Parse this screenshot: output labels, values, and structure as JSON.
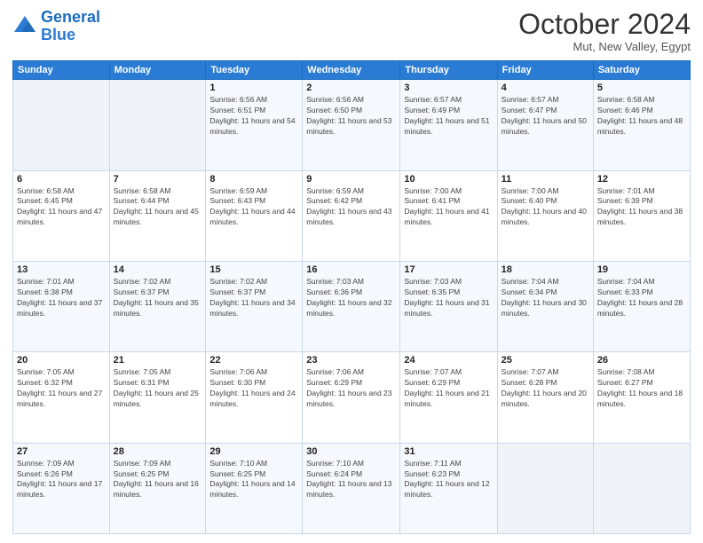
{
  "header": {
    "logo_line1": "General",
    "logo_line2": "Blue",
    "title": "October 2024",
    "subtitle": "Mut, New Valley, Egypt"
  },
  "columns": [
    "Sunday",
    "Monday",
    "Tuesday",
    "Wednesday",
    "Thursday",
    "Friday",
    "Saturday"
  ],
  "weeks": [
    [
      {
        "day": "",
        "sunrise": "",
        "sunset": "",
        "daylight": ""
      },
      {
        "day": "",
        "sunrise": "",
        "sunset": "",
        "daylight": ""
      },
      {
        "day": "1",
        "sunrise": "Sunrise: 6:56 AM",
        "sunset": "Sunset: 6:51 PM",
        "daylight": "Daylight: 11 hours and 54 minutes."
      },
      {
        "day": "2",
        "sunrise": "Sunrise: 6:56 AM",
        "sunset": "Sunset: 6:50 PM",
        "daylight": "Daylight: 11 hours and 53 minutes."
      },
      {
        "day": "3",
        "sunrise": "Sunrise: 6:57 AM",
        "sunset": "Sunset: 6:49 PM",
        "daylight": "Daylight: 11 hours and 51 minutes."
      },
      {
        "day": "4",
        "sunrise": "Sunrise: 6:57 AM",
        "sunset": "Sunset: 6:47 PM",
        "daylight": "Daylight: 11 hours and 50 minutes."
      },
      {
        "day": "5",
        "sunrise": "Sunrise: 6:58 AM",
        "sunset": "Sunset: 6:46 PM",
        "daylight": "Daylight: 11 hours and 48 minutes."
      }
    ],
    [
      {
        "day": "6",
        "sunrise": "Sunrise: 6:58 AM",
        "sunset": "Sunset: 6:45 PM",
        "daylight": "Daylight: 11 hours and 47 minutes."
      },
      {
        "day": "7",
        "sunrise": "Sunrise: 6:58 AM",
        "sunset": "Sunset: 6:44 PM",
        "daylight": "Daylight: 11 hours and 45 minutes."
      },
      {
        "day": "8",
        "sunrise": "Sunrise: 6:59 AM",
        "sunset": "Sunset: 6:43 PM",
        "daylight": "Daylight: 11 hours and 44 minutes."
      },
      {
        "day": "9",
        "sunrise": "Sunrise: 6:59 AM",
        "sunset": "Sunset: 6:42 PM",
        "daylight": "Daylight: 11 hours and 43 minutes."
      },
      {
        "day": "10",
        "sunrise": "Sunrise: 7:00 AM",
        "sunset": "Sunset: 6:41 PM",
        "daylight": "Daylight: 11 hours and 41 minutes."
      },
      {
        "day": "11",
        "sunrise": "Sunrise: 7:00 AM",
        "sunset": "Sunset: 6:40 PM",
        "daylight": "Daylight: 11 hours and 40 minutes."
      },
      {
        "day": "12",
        "sunrise": "Sunrise: 7:01 AM",
        "sunset": "Sunset: 6:39 PM",
        "daylight": "Daylight: 11 hours and 38 minutes."
      }
    ],
    [
      {
        "day": "13",
        "sunrise": "Sunrise: 7:01 AM",
        "sunset": "Sunset: 6:38 PM",
        "daylight": "Daylight: 11 hours and 37 minutes."
      },
      {
        "day": "14",
        "sunrise": "Sunrise: 7:02 AM",
        "sunset": "Sunset: 6:37 PM",
        "daylight": "Daylight: 11 hours and 35 minutes."
      },
      {
        "day": "15",
        "sunrise": "Sunrise: 7:02 AM",
        "sunset": "Sunset: 6:37 PM",
        "daylight": "Daylight: 11 hours and 34 minutes."
      },
      {
        "day": "16",
        "sunrise": "Sunrise: 7:03 AM",
        "sunset": "Sunset: 6:36 PM",
        "daylight": "Daylight: 11 hours and 32 minutes."
      },
      {
        "day": "17",
        "sunrise": "Sunrise: 7:03 AM",
        "sunset": "Sunset: 6:35 PM",
        "daylight": "Daylight: 11 hours and 31 minutes."
      },
      {
        "day": "18",
        "sunrise": "Sunrise: 7:04 AM",
        "sunset": "Sunset: 6:34 PM",
        "daylight": "Daylight: 11 hours and 30 minutes."
      },
      {
        "day": "19",
        "sunrise": "Sunrise: 7:04 AM",
        "sunset": "Sunset: 6:33 PM",
        "daylight": "Daylight: 11 hours and 28 minutes."
      }
    ],
    [
      {
        "day": "20",
        "sunrise": "Sunrise: 7:05 AM",
        "sunset": "Sunset: 6:32 PM",
        "daylight": "Daylight: 11 hours and 27 minutes."
      },
      {
        "day": "21",
        "sunrise": "Sunrise: 7:05 AM",
        "sunset": "Sunset: 6:31 PM",
        "daylight": "Daylight: 11 hours and 25 minutes."
      },
      {
        "day": "22",
        "sunrise": "Sunrise: 7:06 AM",
        "sunset": "Sunset: 6:30 PM",
        "daylight": "Daylight: 11 hours and 24 minutes."
      },
      {
        "day": "23",
        "sunrise": "Sunrise: 7:06 AM",
        "sunset": "Sunset: 6:29 PM",
        "daylight": "Daylight: 11 hours and 23 minutes."
      },
      {
        "day": "24",
        "sunrise": "Sunrise: 7:07 AM",
        "sunset": "Sunset: 6:29 PM",
        "daylight": "Daylight: 11 hours and 21 minutes."
      },
      {
        "day": "25",
        "sunrise": "Sunrise: 7:07 AM",
        "sunset": "Sunset: 6:28 PM",
        "daylight": "Daylight: 11 hours and 20 minutes."
      },
      {
        "day": "26",
        "sunrise": "Sunrise: 7:08 AM",
        "sunset": "Sunset: 6:27 PM",
        "daylight": "Daylight: 11 hours and 18 minutes."
      }
    ],
    [
      {
        "day": "27",
        "sunrise": "Sunrise: 7:09 AM",
        "sunset": "Sunset: 6:26 PM",
        "daylight": "Daylight: 11 hours and 17 minutes."
      },
      {
        "day": "28",
        "sunrise": "Sunrise: 7:09 AM",
        "sunset": "Sunset: 6:25 PM",
        "daylight": "Daylight: 11 hours and 16 minutes."
      },
      {
        "day": "29",
        "sunrise": "Sunrise: 7:10 AM",
        "sunset": "Sunset: 6:25 PM",
        "daylight": "Daylight: 11 hours and 14 minutes."
      },
      {
        "day": "30",
        "sunrise": "Sunrise: 7:10 AM",
        "sunset": "Sunset: 6:24 PM",
        "daylight": "Daylight: 11 hours and 13 minutes."
      },
      {
        "day": "31",
        "sunrise": "Sunrise: 7:11 AM",
        "sunset": "Sunset: 6:23 PM",
        "daylight": "Daylight: 11 hours and 12 minutes."
      },
      {
        "day": "",
        "sunrise": "",
        "sunset": "",
        "daylight": ""
      },
      {
        "day": "",
        "sunrise": "",
        "sunset": "",
        "daylight": ""
      }
    ]
  ]
}
